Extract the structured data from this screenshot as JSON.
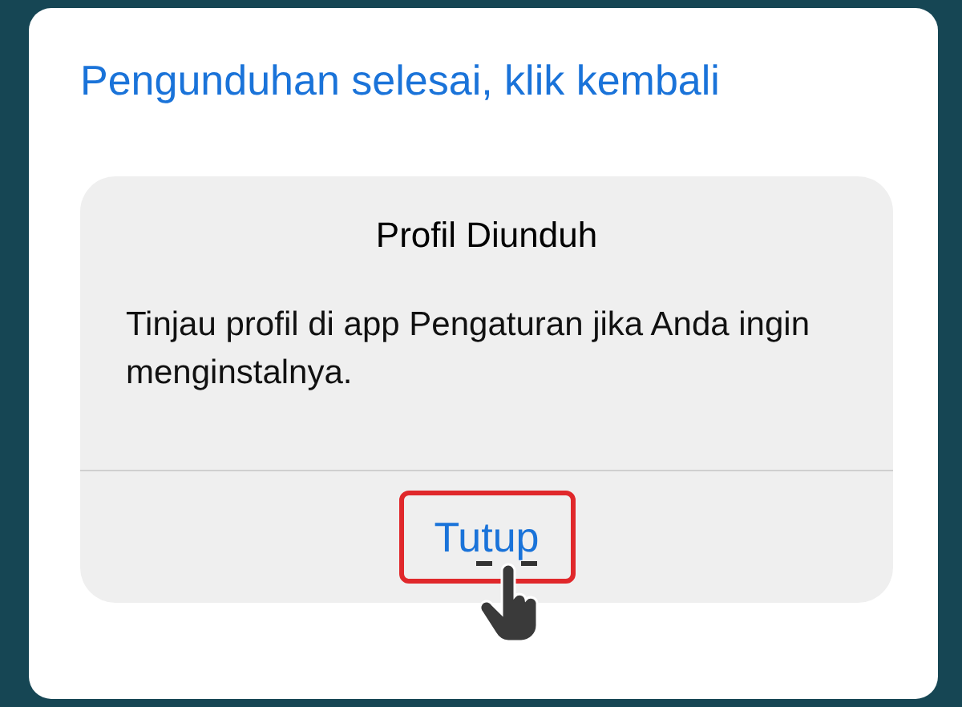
{
  "heading": "Pengunduhan selesai, klik kembali",
  "alert": {
    "title": "Profil Diunduh",
    "message": "Tinjau profil di app Pengaturan jika Anda ingin menginstalnya.",
    "button": {
      "label": "Tutup",
      "highlighted": true
    }
  }
}
